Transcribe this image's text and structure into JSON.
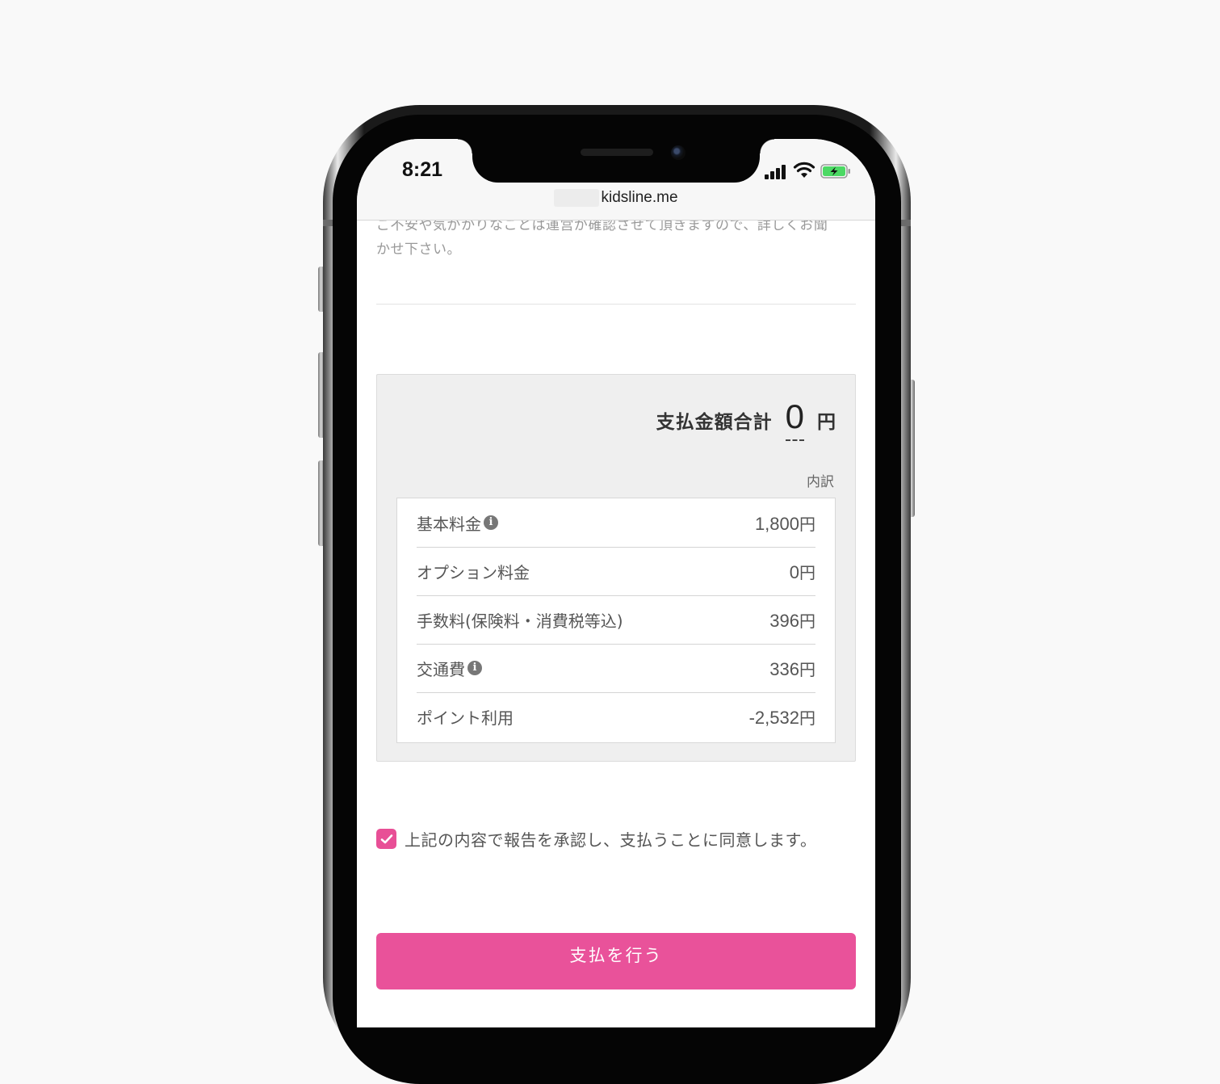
{
  "status_bar": {
    "time": "8:21",
    "url": "kidsline.me"
  },
  "notice": {
    "line1": "ご不安や気がかりなことは運営が確認させて頂きますので、詳しくお聞",
    "line2": "かせ下さい。"
  },
  "summary": {
    "total_label": "支払金額合計",
    "total_value": "0",
    "total_unit": "円",
    "breakdown_label": "内訳",
    "rows": [
      {
        "label": "基本料金",
        "value": "1,800",
        "unit": "円",
        "info": true
      },
      {
        "label": "オプション料金",
        "value": "0",
        "unit": "円",
        "info": false
      },
      {
        "label": "手数料(保険料・消費税等込)",
        "value": "396",
        "unit": "円",
        "info": false
      },
      {
        "label": "交通費",
        "value": "336",
        "unit": "円",
        "info": true
      },
      {
        "label": "ポイント利用",
        "value": "-2,532",
        "unit": "円",
        "info": false
      }
    ]
  },
  "agreement": {
    "checked": true,
    "label": "上記の内容で報告を承認し、支払うことに同意します。"
  },
  "pay_button": {
    "label": "支払を行う"
  },
  "colors": {
    "accent": "#e9529a",
    "highlight": "#ff2a0c"
  },
  "icons": {
    "info": "info-icon",
    "signal": "cellular-signal-icon",
    "wifi": "wifi-icon",
    "battery": "battery-charging-icon",
    "check": "checkmark-icon"
  }
}
